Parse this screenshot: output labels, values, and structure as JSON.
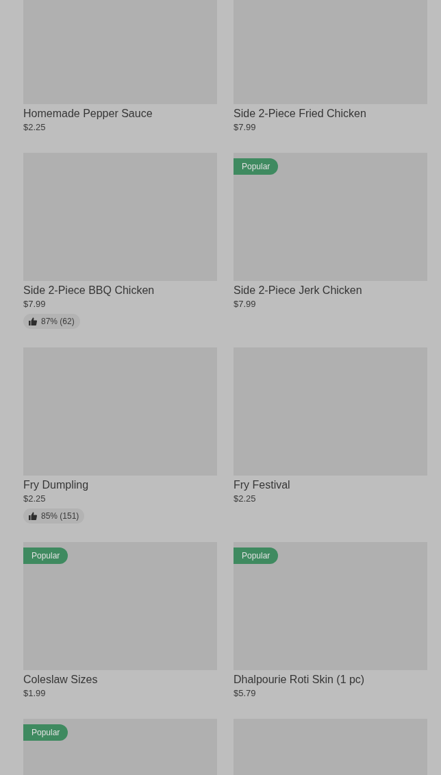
{
  "items": [
    {
      "kind": "menu_item",
      "name": "Homemade Pepper Sauce",
      "price": "$2.25"
    },
    {
      "kind": "menu_item",
      "name": "Side 2-Piece Fried Chicken",
      "price": "$7.99"
    },
    {
      "kind": "menu_item",
      "name": "Side 2-Piece BBQ Chicken",
      "price": "$7.99",
      "rating": "87% (62)"
    },
    {
      "kind": "menu_item",
      "badge": "Popular",
      "name": "Side 2-Piece Jerk Chicken",
      "price": "$7.99"
    },
    {
      "kind": "menu_item",
      "name": "Fry Dumpling",
      "price": "$2.25",
      "rating": "85% (151)"
    },
    {
      "kind": "menu_item",
      "name": "Fry Festival",
      "price": "$2.25"
    },
    {
      "kind": "menu_item",
      "badge": "Popular",
      "name": "Coleslaw Sizes",
      "price": "$1.99"
    },
    {
      "kind": "menu_item",
      "badge": "Popular",
      "name": "Dhalpourie Roti Skin (1 pc)",
      "price": "$5.79"
    },
    {
      "kind": "menu_item",
      "badge": "Popular"
    },
    {
      "kind": "menu_item"
    }
  ]
}
